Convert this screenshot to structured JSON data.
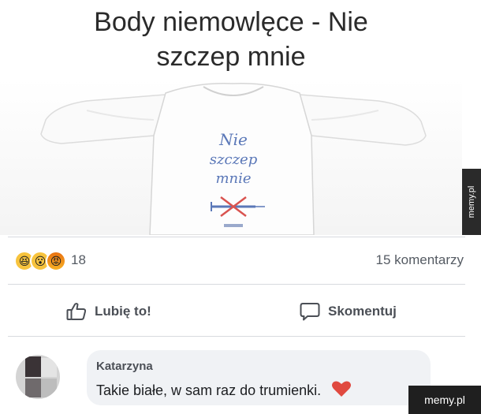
{
  "post": {
    "title_line1": "Body niemowlęce - Nie",
    "title_line2": "szczep mnie",
    "image_print": [
      "Nie",
      "szczep",
      "mnie"
    ]
  },
  "watermark": {
    "side_text": "memy.pl",
    "corner_text": "memy.pl"
  },
  "reactions": {
    "icons": [
      "haha-icon",
      "wow-icon",
      "angry-icon"
    ],
    "count": "18",
    "comments_label": "15 komentarzy"
  },
  "actions": {
    "like_label": "Lubię to!",
    "comment_label": "Skomentuj"
  },
  "comment": {
    "author": "Katarzyna",
    "text": "Takie białe, w sam raz do trumienki."
  },
  "colors": {
    "bubble": "#f0f2f5",
    "heart": "#e0493f",
    "print": "#5b78b8"
  }
}
